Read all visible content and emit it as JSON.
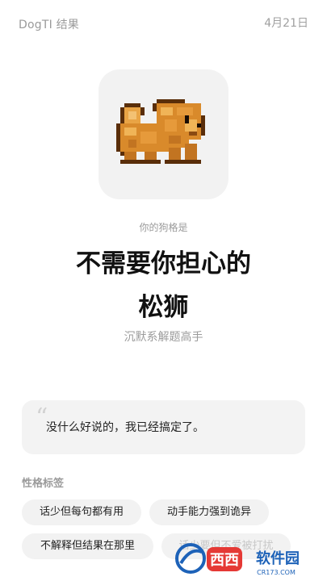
{
  "header": {
    "app_title": "DogTI 结果",
    "date": "4月21日"
  },
  "result": {
    "prefix": "你的狗格是",
    "title_line1": "不需要你担心的",
    "title_line2": "松狮",
    "tagline": "沉默系解题高手"
  },
  "quote": {
    "text": "没什么好说的，我已经搞定了。"
  },
  "traits": {
    "label": "性格标签",
    "tags": [
      "话少但每句都有用",
      "动手能力强到诡异",
      "不解释但结果在那里",
      "话少要但不爱被打扰"
    ]
  },
  "watermark": {
    "text": "西西软件园",
    "sub": "CR173.COM"
  },
  "colors": {
    "dog_main": "#d98a2b",
    "dog_dark": "#8a4a12",
    "dog_light": "#f0b457",
    "card_bg": "#f2f2f2"
  }
}
